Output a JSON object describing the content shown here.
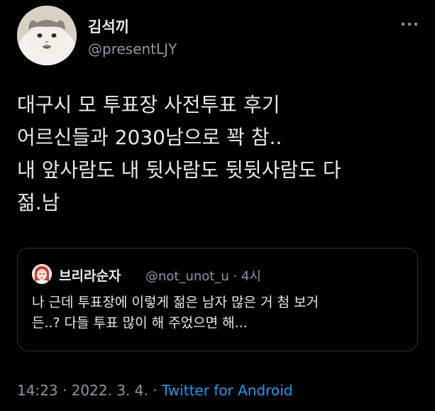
{
  "author": {
    "display_name": "김석끼",
    "handle": "@presentLJY",
    "avatar_icon": "cat-avatar-icon"
  },
  "tweet": {
    "lines": [
      "대구시 모 투표장 사전투표 후기",
      "어르신들과 2030남으로 꽉 참..",
      "내 앞사람도 내 뒷사람도 뒷뒷사람도 다",
      "젊.남"
    ]
  },
  "quote": {
    "display_name": "브리라순자",
    "handle_time": "@not_unot_u · 4시",
    "lines": [
      "나 근데 투표장에 이렇게 젊은 남자 많은 거 첨 보거",
      "든..? 다들 투표 많이 해 주었으면 해..."
    ]
  },
  "meta": {
    "time_date": "14:23 · 2022. 3. 4. · ",
    "source": "Twitter for Android"
  },
  "colors": {
    "background": "#000000",
    "primary_text": "#e7e9ea",
    "secondary_text": "#8b98a5",
    "link": "#1d9bf0",
    "border": "#2f3336"
  },
  "icons": {
    "more": "more-horizontal-icon"
  }
}
